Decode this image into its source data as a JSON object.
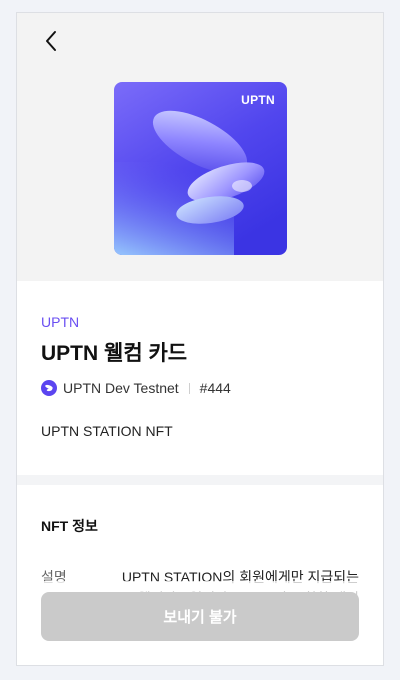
{
  "nft_image": {
    "brand": "UPTN",
    "colors": {
      "top": "#6a64f6",
      "bottom": "#3d33e6",
      "accent": "#b6d4ff"
    }
  },
  "collection": "UPTN",
  "title": "UPTN 웰컴 카드",
  "network": {
    "icon": "uptn-network-icon",
    "name": "UPTN Dev Testnet"
  },
  "token_id": "#444",
  "description": "UPTN STATION NFT",
  "nft_info": {
    "section_title": "NFT 정보",
    "rows": [
      {
        "label": "설명",
        "value": "UPTN STATION의 회원에게만 지급되는 웰컴카드입니다. UPTN이 주최한 재미"
      }
    ]
  },
  "send_button": {
    "label": "보내기 불가",
    "enabled": false
  },
  "colors": {
    "accent": "#6a4ff2",
    "button_disabled": "#cacaca"
  }
}
